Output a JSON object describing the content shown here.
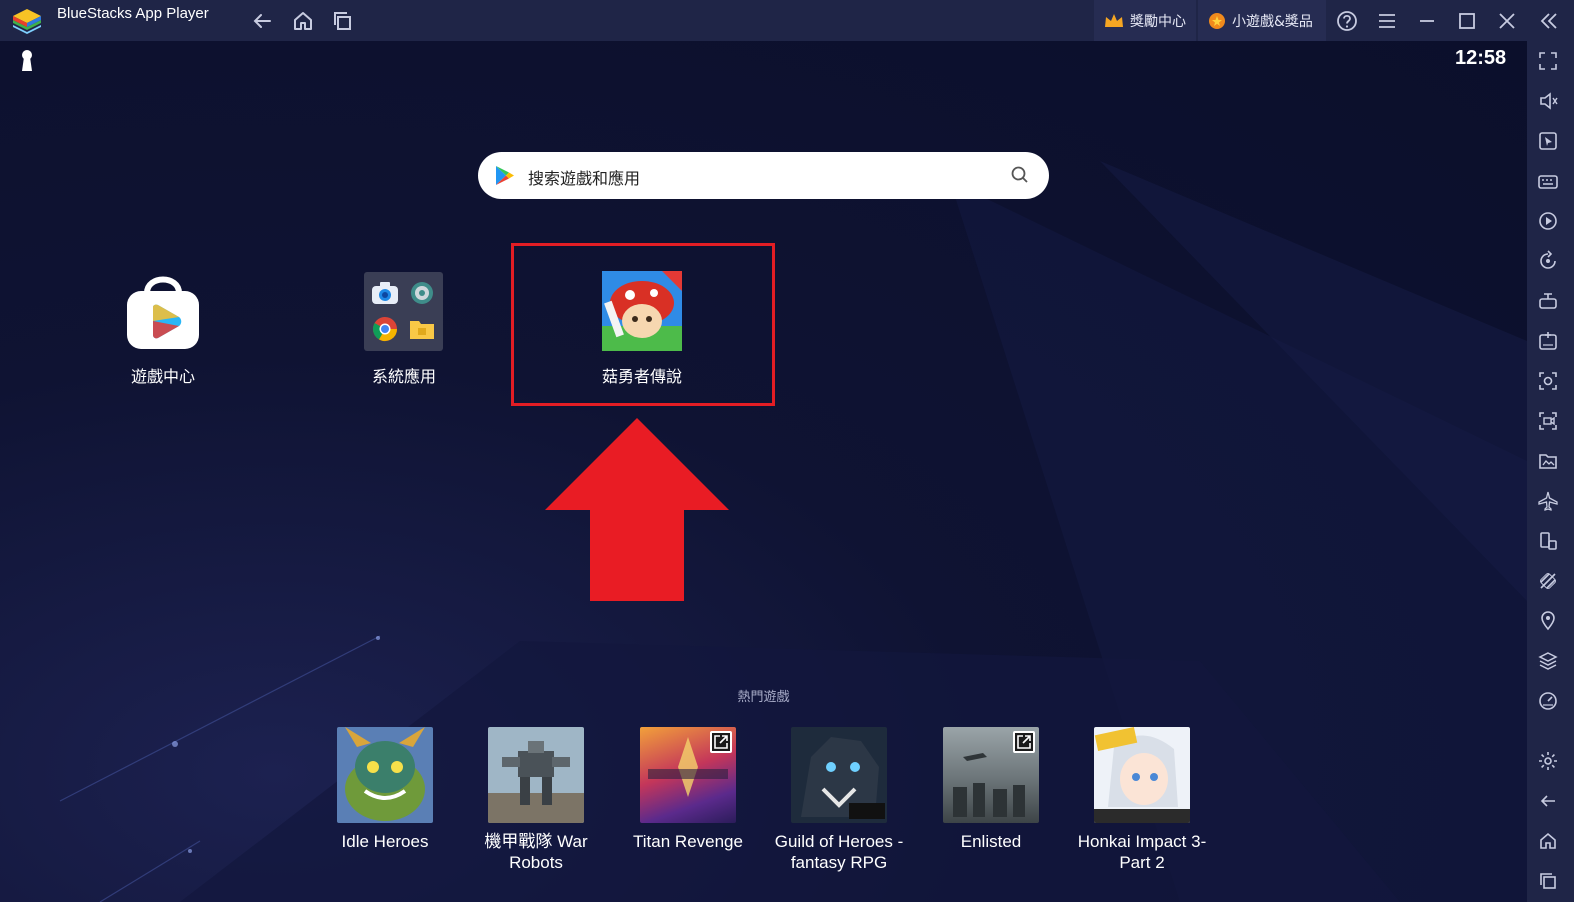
{
  "window": {
    "title": "BlueStacks App Player",
    "rewards_label": "獎勵中心",
    "minigames_label": "小遊戲&獎品"
  },
  "status": {
    "time": "12:58"
  },
  "search": {
    "placeholder": "搜索遊戲和應用"
  },
  "home_apps": [
    {
      "label": "遊戲中心"
    },
    {
      "label": "系統應用"
    },
    {
      "label": "菇勇者傳說"
    }
  ],
  "popular": {
    "title": "熱門遊戲",
    "games": [
      {
        "title": "Idle Heroes"
      },
      {
        "title": "機甲戰隊 War Robots"
      },
      {
        "title": "Titan Revenge"
      },
      {
        "title": "Guild of Heroes - fantasy RPG"
      },
      {
        "title": "Enlisted"
      },
      {
        "title": "Honkai Impact 3-Part 2"
      }
    ]
  },
  "colors": {
    "highlight": "#e31d24",
    "titlebar": "#1f2547",
    "background": "#0d1130"
  }
}
